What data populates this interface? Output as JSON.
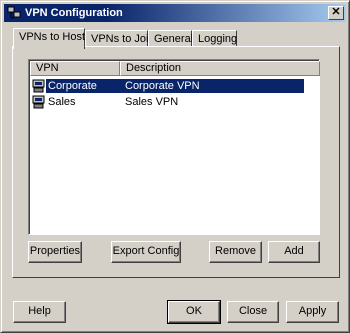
{
  "window": {
    "title": "VPN Configuration",
    "close_glyph": "✕"
  },
  "tabs": [
    {
      "label": "VPNs to Host",
      "active": true
    },
    {
      "label": "VPNs to Join",
      "active": false
    },
    {
      "label": "General",
      "active": false
    },
    {
      "label": "Logging",
      "active": false
    }
  ],
  "vpn_list": {
    "columns": [
      "VPN",
      "Description"
    ],
    "rows": [
      {
        "vpn": "Corporate",
        "description": "Corporate VPN",
        "selected": true,
        "icon": "network-computer-icon"
      },
      {
        "vpn": "Sales",
        "description": "Sales VPN",
        "selected": false,
        "icon": "network-computer-icon"
      }
    ]
  },
  "tab_buttons": {
    "properties": "Properties",
    "export_config": "Export Config",
    "remove": "Remove",
    "add": "Add"
  },
  "dialog_buttons": {
    "help": "Help",
    "ok": "OK",
    "close": "Close",
    "apply": "Apply"
  },
  "colors": {
    "selection": "#0a246a",
    "face": "#d4d0c8",
    "title_start": "#0a246a",
    "title_end": "#a6caf0"
  }
}
